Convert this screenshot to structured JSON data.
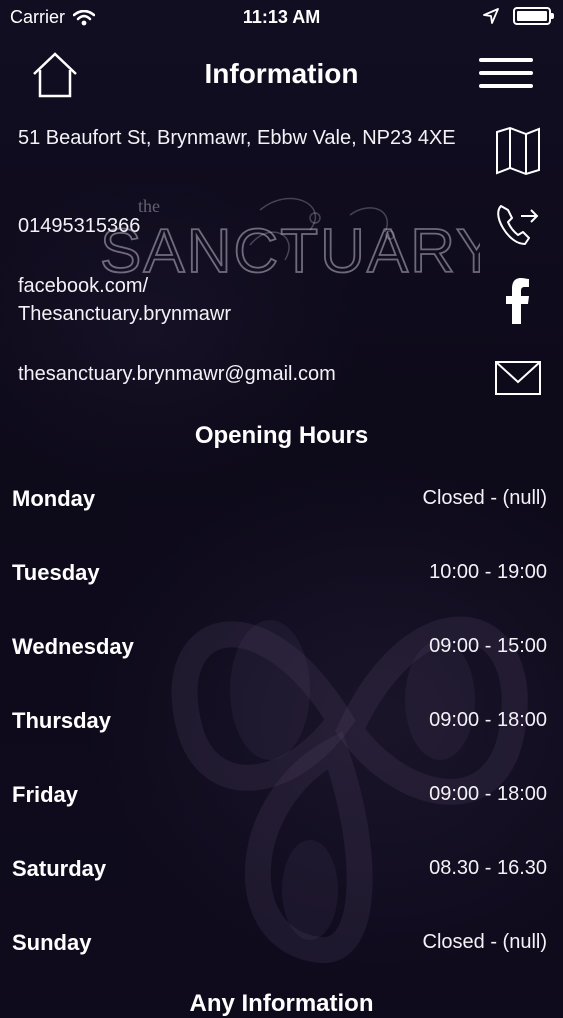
{
  "status_bar": {
    "carrier": "Carrier",
    "time": "11:13 AM"
  },
  "nav": {
    "title": "Information"
  },
  "logo": {
    "small_text": "the",
    "main_text": "SANCTUARY"
  },
  "contact": {
    "address": "51 Beaufort St, Brynmawr, Ebbw Vale, NP23 4XE",
    "phone": "01495315366",
    "facebook_line1": "facebook.com/",
    "facebook_line2": "Thesanctuary.brynmawr",
    "email": "thesanctuary.brynmawr@gmail.com"
  },
  "opening_hours": {
    "title": "Opening Hours",
    "rows": [
      {
        "day": "Monday",
        "hours": "Closed - (null)"
      },
      {
        "day": "Tuesday",
        "hours": "10:00 - 19:00"
      },
      {
        "day": "Wednesday",
        "hours": "09:00 - 15:00"
      },
      {
        "day": "Thursday",
        "hours": "09:00 - 18:00"
      },
      {
        "day": "Friday",
        "hours": "09:00 - 18:00"
      },
      {
        "day": "Saturday",
        "hours": "08.30 - 16.30"
      },
      {
        "day": "Sunday",
        "hours": "Closed - (null)"
      }
    ]
  },
  "next_section": {
    "title": "Any Information"
  },
  "icons": {
    "wifi": "wifi-icon",
    "location": "location-arrow-icon",
    "battery": "battery-icon",
    "home": "home-icon",
    "menu": "hamburger-menu-icon",
    "map": "map-icon",
    "phone": "phone-call-icon",
    "facebook": "facebook-icon",
    "email": "envelope-icon"
  },
  "colors": {
    "background": "#0e0b1c",
    "text": "#ffffff"
  }
}
